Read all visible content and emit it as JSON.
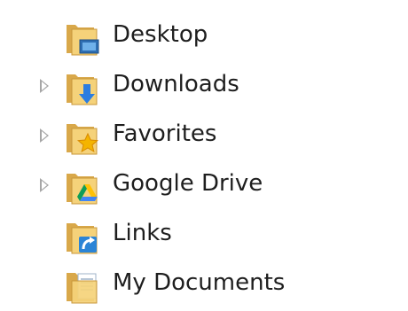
{
  "tree": {
    "items": [
      {
        "label": "Desktop",
        "icon": "desktop-folder-icon",
        "expandable": false
      },
      {
        "label": "Downloads",
        "icon": "downloads-folder-icon",
        "expandable": true
      },
      {
        "label": "Favorites",
        "icon": "favorites-folder-icon",
        "expandable": true
      },
      {
        "label": "Google Drive",
        "icon": "google-drive-folder-icon",
        "expandable": true
      },
      {
        "label": "Links",
        "icon": "links-folder-icon",
        "expandable": false
      },
      {
        "label": "My Documents",
        "icon": "documents-folder-icon",
        "expandable": false
      }
    ]
  }
}
